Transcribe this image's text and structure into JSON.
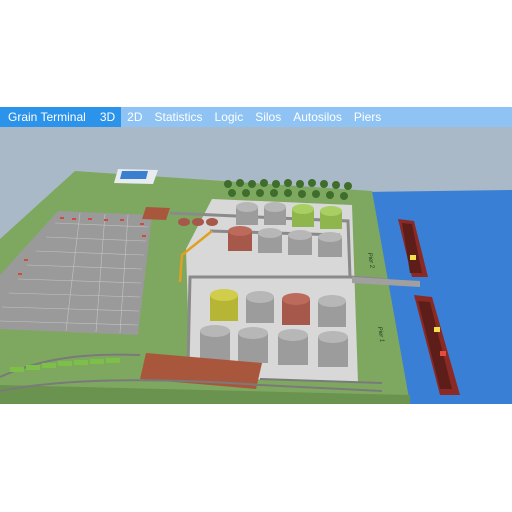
{
  "app": {
    "title": "Grain Terminal"
  },
  "menu": {
    "items": [
      {
        "label": "3D",
        "active": true
      },
      {
        "label": "2D",
        "active": false
      },
      {
        "label": "Statistics",
        "active": false
      },
      {
        "label": "Logic",
        "active": false
      },
      {
        "label": "Silos",
        "active": false
      },
      {
        "label": "Autosilos",
        "active": false
      },
      {
        "label": "Piers",
        "active": false
      }
    ]
  },
  "scene": {
    "pier_labels": [
      "Pier 2",
      "Pier 1"
    ],
    "colors": {
      "sky": "#a9b9c7",
      "grass": "#7ea860",
      "water": "#3a7fd6",
      "concrete": "#d8d8d8",
      "parking": "#9a9a9a",
      "silo_gray": "#9c9c9c",
      "silo_red": "#a6584a",
      "silo_yellow": "#b7b535",
      "silo_green": "#8fb64c",
      "brand_blue": "#2b93e9",
      "menu_blue": "#8ec3f3"
    }
  }
}
